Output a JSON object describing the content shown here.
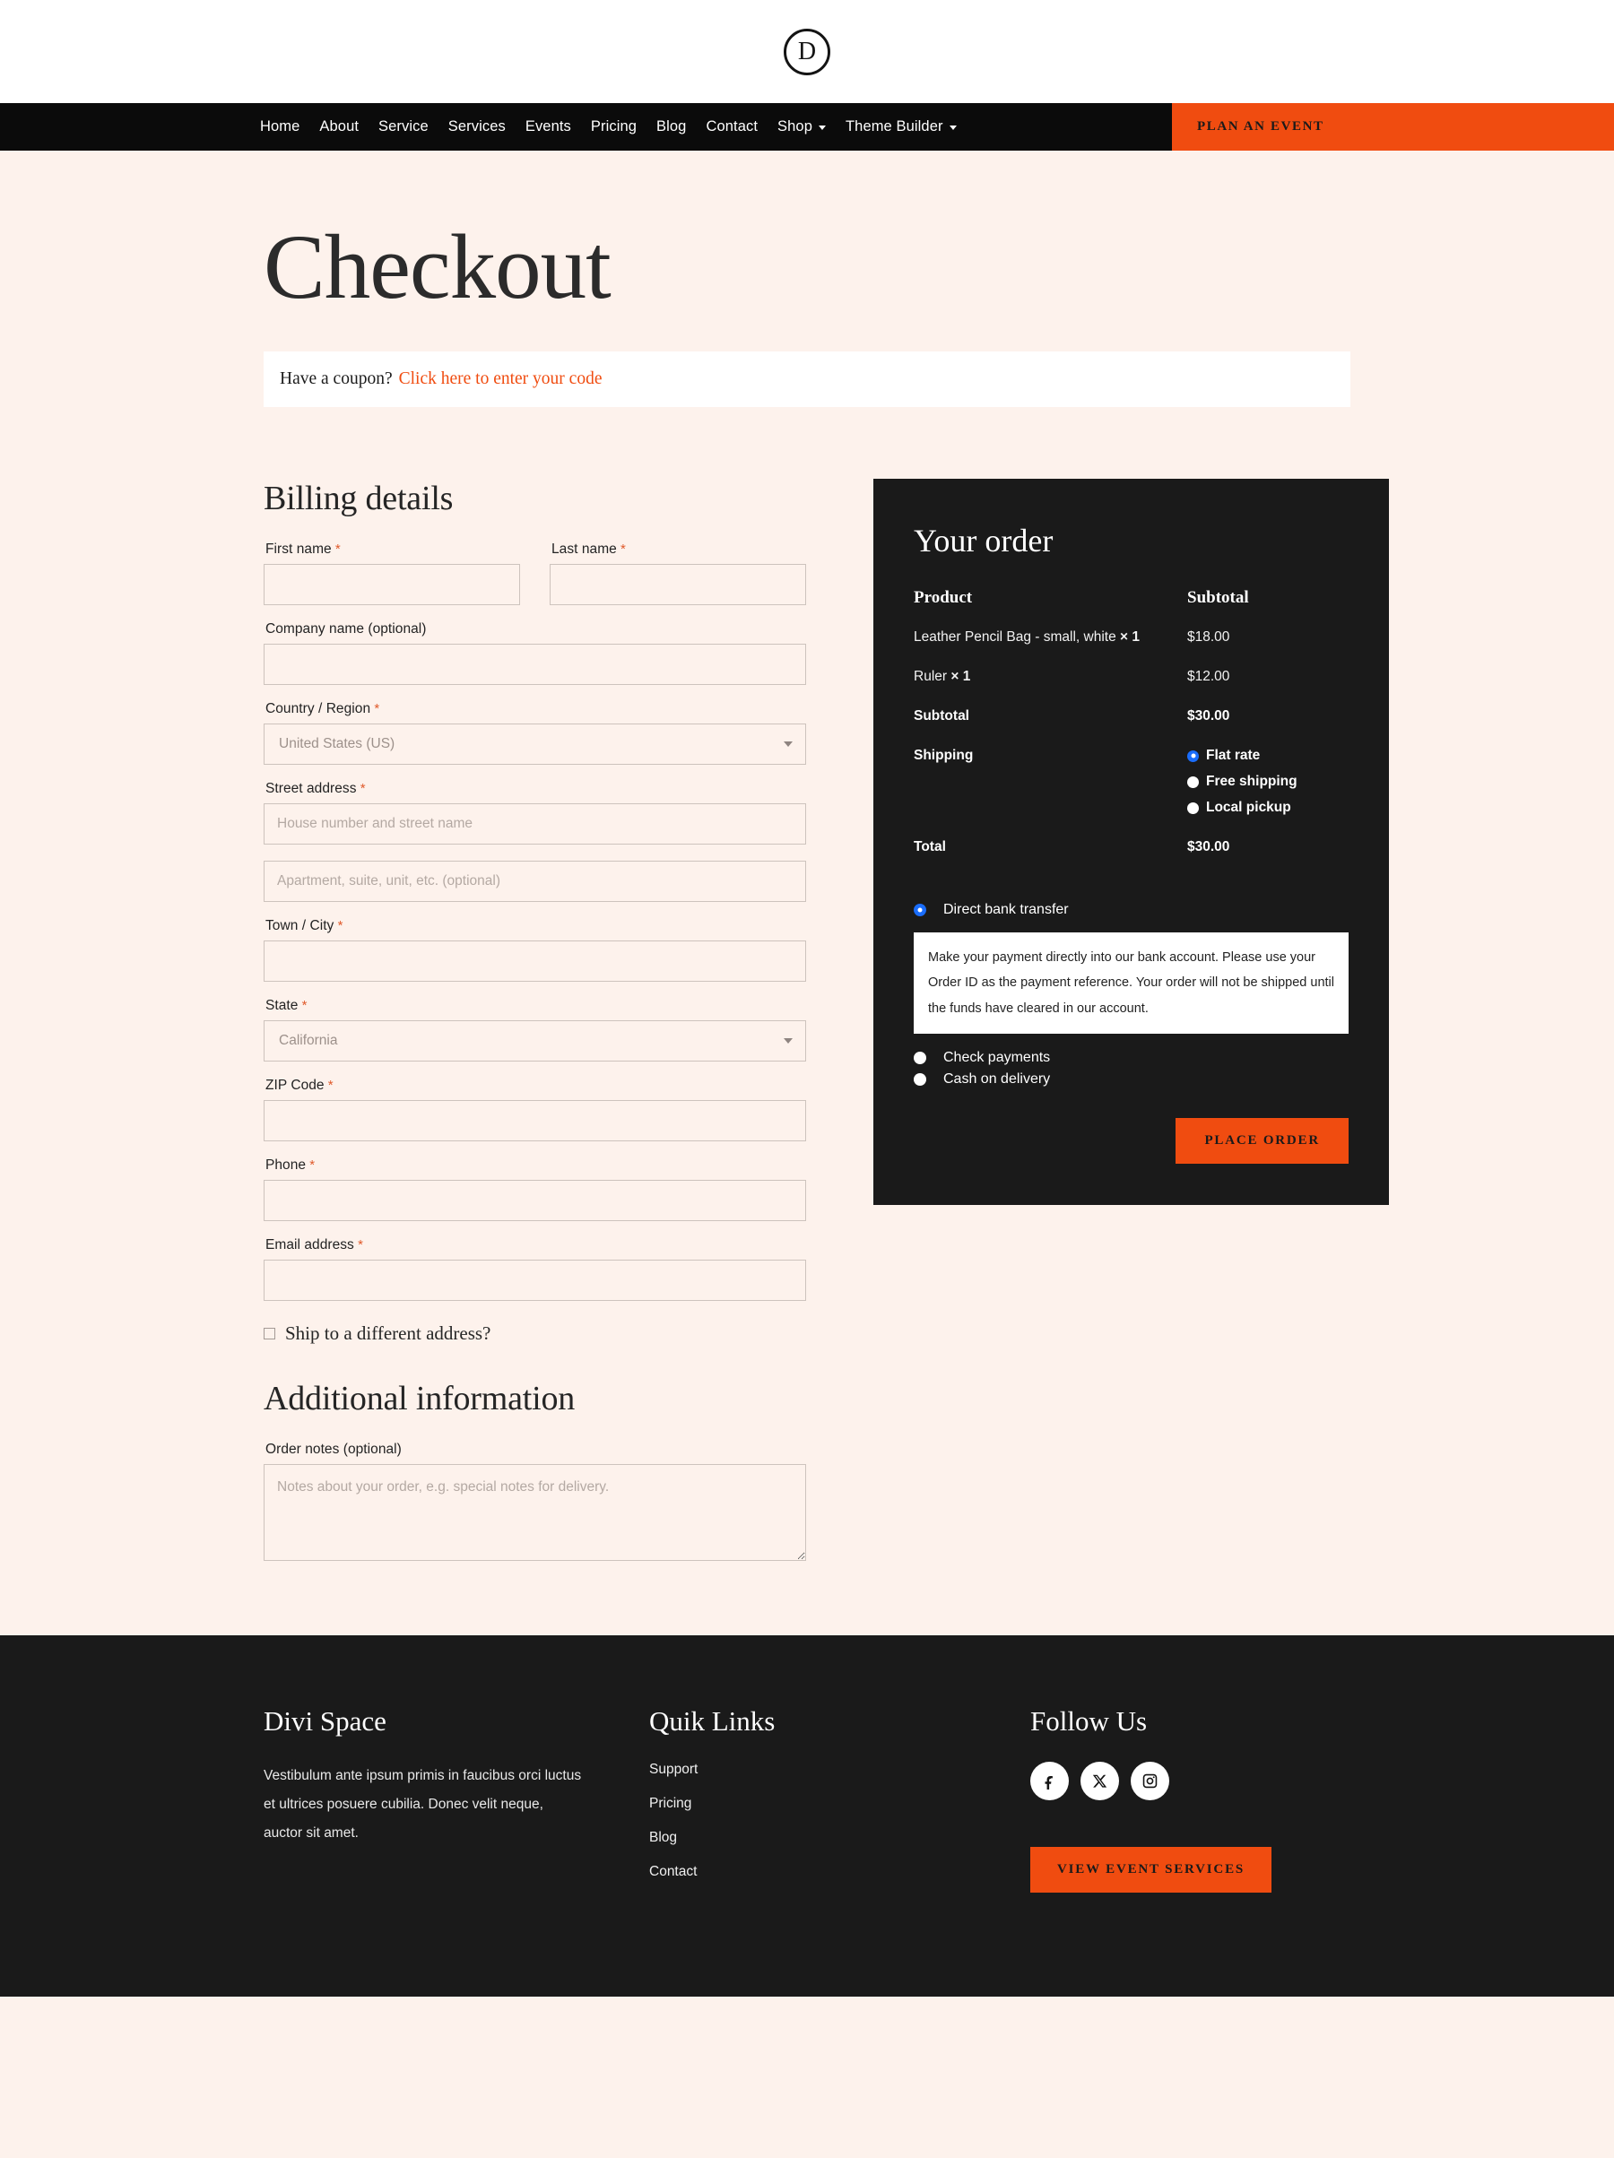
{
  "brand": {
    "logo_letter": "D"
  },
  "nav": {
    "items": [
      {
        "label": "Home",
        "has_dropdown": false
      },
      {
        "label": "About",
        "has_dropdown": false
      },
      {
        "label": "Service",
        "has_dropdown": false
      },
      {
        "label": "Services",
        "has_dropdown": false
      },
      {
        "label": "Events",
        "has_dropdown": false
      },
      {
        "label": "Pricing",
        "has_dropdown": false
      },
      {
        "label": "Blog",
        "has_dropdown": false
      },
      {
        "label": "Contact",
        "has_dropdown": false
      },
      {
        "label": "Shop",
        "has_dropdown": true
      },
      {
        "label": "Theme Builder",
        "has_dropdown": true
      }
    ],
    "cta_label": "PLAN AN EVENT"
  },
  "page": {
    "title": "Checkout"
  },
  "coupon": {
    "prompt": "Have a coupon?",
    "link_label": "Click here to enter your code"
  },
  "billing": {
    "heading": "Billing details",
    "first_name": {
      "label": "First name",
      "required": true,
      "value": "",
      "placeholder": ""
    },
    "last_name": {
      "label": "Last name",
      "required": true,
      "value": "",
      "placeholder": ""
    },
    "company": {
      "label": "Company name (optional)",
      "required": false,
      "value": "",
      "placeholder": ""
    },
    "country": {
      "label": "Country / Region",
      "required": true,
      "value": "United States (US)"
    },
    "street": {
      "label": "Street address",
      "required": true,
      "value": "",
      "placeholder": "House number and street name"
    },
    "street2": {
      "value": "",
      "placeholder": "Apartment, suite, unit, etc. (optional)"
    },
    "city": {
      "label": "Town / City",
      "required": true,
      "value": "",
      "placeholder": ""
    },
    "state": {
      "label": "State",
      "required": true,
      "value": "California"
    },
    "zip": {
      "label": "ZIP Code",
      "required": true,
      "value": "",
      "placeholder": ""
    },
    "phone": {
      "label": "Phone",
      "required": true,
      "value": "",
      "placeholder": ""
    },
    "email": {
      "label": "Email address",
      "required": true,
      "value": "",
      "placeholder": ""
    },
    "ship_different_label": "Ship to a different address?",
    "ship_different_checked": false
  },
  "additional": {
    "heading": "Additional information",
    "notes_label": "Order notes (optional)",
    "notes_value": "",
    "notes_placeholder": "Notes about your order, e.g. special notes for delivery."
  },
  "order": {
    "title": "Your order",
    "header_product": "Product",
    "header_subtotal": "Subtotal",
    "items": [
      {
        "name": "Leather Pencil Bag - small, white",
        "qty": "× 1",
        "subtotal": "$18.00"
      },
      {
        "name": "Ruler",
        "qty": "× 1",
        "subtotal": "$12.00"
      }
    ],
    "subtotal_label": "Subtotal",
    "subtotal_value": "$30.00",
    "shipping_label": "Shipping",
    "shipping_options": [
      {
        "label": "Flat rate",
        "selected": true
      },
      {
        "label": "Free shipping",
        "selected": false
      },
      {
        "label": "Local pickup",
        "selected": false
      }
    ],
    "total_label": "Total",
    "total_value": "$30.00",
    "payment_methods": [
      {
        "label": "Direct bank transfer",
        "selected": true
      },
      {
        "label": "Check payments",
        "selected": false
      },
      {
        "label": "Cash on delivery",
        "selected": false
      }
    ],
    "bank_transfer_note": "Make your payment directly into our bank account. Please use your Order ID as the payment reference. Your order will not be shipped until the funds have cleared in our account.",
    "place_order_label": "PLACE ORDER"
  },
  "footer": {
    "col1": {
      "heading": "Divi Space",
      "text": "Vestibulum ante ipsum primis in faucibus orci luctus et ultrices posuere cubilia. Donec velit neque, auctor sit amet."
    },
    "col2": {
      "heading": "Quik Links",
      "links": [
        "Support",
        "Pricing",
        "Blog",
        "Contact"
      ]
    },
    "col3": {
      "heading": "Follow Us",
      "socials": [
        "facebook-icon",
        "x-twitter-icon",
        "instagram-icon"
      ],
      "cta_label": "VIEW EVENT SERVICES"
    }
  },
  "colors": {
    "accent_orange": "#f04c10",
    "page_background": "#fdf2ec",
    "dark_panel": "#1a1a1a",
    "nav_black": "#0b0b0b",
    "radio_blue": "#1a6dfb",
    "required_star": "#e05a2b"
  }
}
